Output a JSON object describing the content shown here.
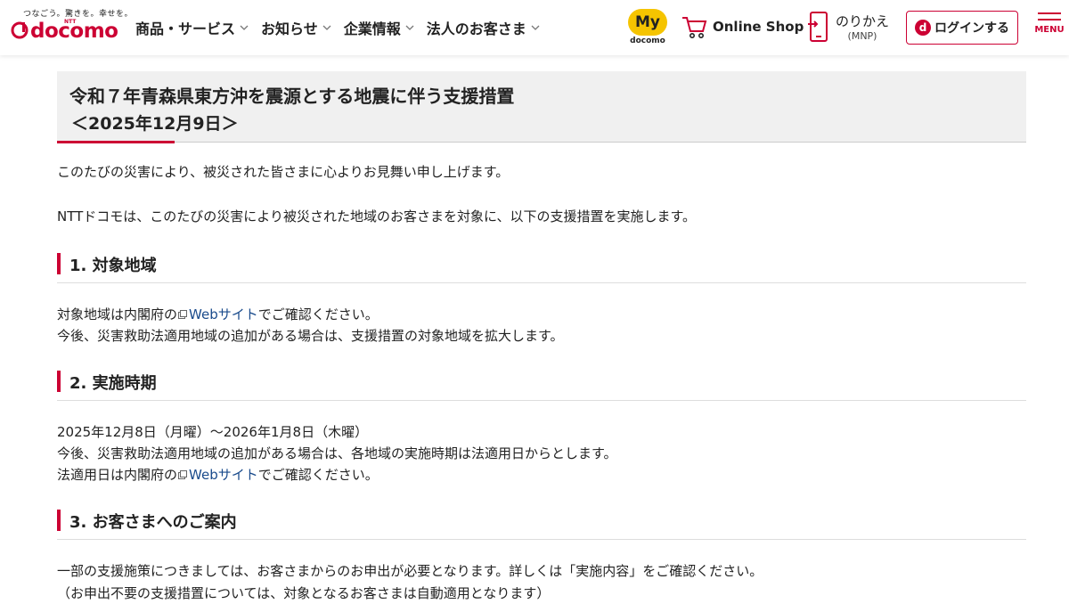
{
  "header": {
    "logo": {
      "tagline": "つなごう。驚きを。幸せを。",
      "ntt": "NTT",
      "brand": "docomo"
    },
    "nav": [
      {
        "label": "商品・サービス"
      },
      {
        "label": "お知らせ"
      },
      {
        "label": "企業情報"
      },
      {
        "label": "法人のお客さま"
      }
    ],
    "my": {
      "label": "My",
      "sub": "docomo"
    },
    "online_shop": {
      "label": "Online Shop",
      "icon": "cart-icon"
    },
    "mnp": {
      "label": "のりかえ",
      "sub": "(MNP)",
      "icon": "phone-transfer-icon"
    },
    "login": {
      "badge": "d",
      "label": "ログインする"
    },
    "menu": {
      "label": "MENU"
    },
    "colors": {
      "brand": "#cc0033",
      "my_yellow": "#f5c400",
      "link": "#1a4b8c"
    }
  },
  "page": {
    "title": "令和７年青森県東方沖を震源とする地震に伴う支援措置",
    "date": "＜2025年12月9日＞",
    "intro1": "このたびの災害により、被災された皆さまに心よりお見舞い申し上げます。",
    "intro2": "NTTドコモは、このたびの災害により被災された地域のお客さまを対象に、以下の支援措置を実施します。",
    "sections": [
      {
        "heading": "1.  対象地域",
        "line1_pre": "対象地域は内閣府の",
        "line1_link": "Webサイト",
        "line1_post": "でご確認ください。",
        "line2": "今後、災害救助法適用地域の追加がある場合は、支援措置の対象地域を拡大します。"
      },
      {
        "heading": "2.  実施時期",
        "line1": "2025年12月8日（月曜）～2026年1月8日（木曜）",
        "line2": "今後、災害救助法適用地域の追加がある場合は、各地域の実施時期は法適用日からとします。",
        "line3_pre": "法適用日は内閣府の",
        "line3_link": "Webサイト",
        "line3_post": "でご確認ください。"
      },
      {
        "heading": "3.  お客さまへのご案内",
        "line1": "一部の支援施策につきましては、お客さまからのお申出が必要となります。詳しくは「実施内容」をご確認ください。",
        "line2": "（お申出不要の支援措置については、対象となるお客さまは自動適用となります）"
      }
    ]
  }
}
